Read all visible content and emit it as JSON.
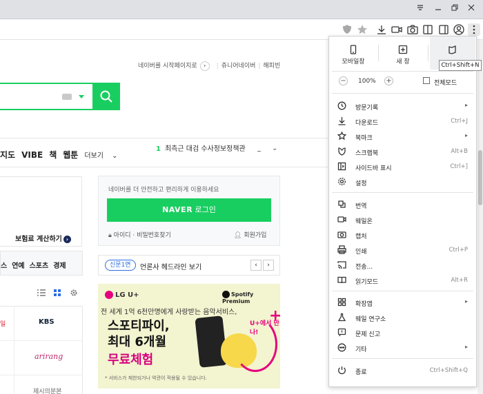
{
  "window": {
    "controls": [
      "tabs-dropdown-icon",
      "minimize-icon",
      "restore-icon",
      "close-icon"
    ]
  },
  "toolbar": {
    "icons": [
      "shield-icon",
      "star-icon",
      "download-icon",
      "camera-video-icon",
      "camera-icon",
      "sidebar-icon",
      "profile-icon",
      "menu-icon"
    ]
  },
  "page": {
    "topline": {
      "start_page": "네이버를 시작페이지로",
      "junior": "쥬니어네이버",
      "happybean": "해피빈"
    },
    "nav": {
      "items": [
        "지도",
        "VIBE",
        "책",
        "웹툰"
      ],
      "more": "더보기"
    },
    "trend": {
      "rank": "1",
      "text": "최측근 대검 수사정보정책관",
      "dash": "_"
    },
    "insurance_link": "보험료 계산하기",
    "category_tabs": [
      "스",
      "연예",
      "스포츠",
      "경제"
    ],
    "login": {
      "message": "네이버를 더 안전하고 편리하게 이용하세요",
      "button_brand": "NAVER",
      "button_label": "로그인",
      "links": "아이디 · 비밀번호찾기",
      "join": "회원가입"
    },
    "news": {
      "badge": "신문1면",
      "text": "언론사 헤드라인 보기"
    },
    "press": {
      "logos": [
        "KBS",
        "arirang",
        "제시의분본"
      ],
      "left_fragments": [
        "일",
        "",
        ""
      ]
    },
    "ad": {
      "brand_left": "LG U+",
      "brand_right": "Spotify Premium",
      "line1": "전 세계 1억 6천만명에게 사랑받는 음악서비스,",
      "headline1": "스포티파이,",
      "headline2": "최대 6개월",
      "headline3": "무료체험",
      "badge": "U+에서 만나!",
      "footnote": "* 서비스가 제한되거나 약관이 적용될 수 있습니다."
    }
  },
  "menu": {
    "top": [
      {
        "label": "모바일창",
        "icon": "mobile-icon"
      },
      {
        "label": "새 창",
        "icon": "new-window-icon"
      },
      {
        "label": "",
        "icon": "private-window-icon"
      }
    ],
    "tooltip": "Ctrl+Shift+N",
    "zoom": {
      "minus": "−",
      "value": "100%",
      "plus": "+",
      "fullscreen": "전체모드"
    },
    "group1": [
      {
        "label": "방문기록",
        "shortcut": "",
        "arrow": "▸",
        "icon": "history-icon"
      },
      {
        "label": "다운로드",
        "shortcut": "Ctrl+J",
        "arrow": "",
        "icon": "download-icon"
      },
      {
        "label": "북마크",
        "shortcut": "",
        "arrow": "▸",
        "icon": "star-icon"
      },
      {
        "label": "스크랩북",
        "shortcut": "Alt+B",
        "arrow": "",
        "icon": "scrapbook-icon"
      },
      {
        "label": "사이드바 표시",
        "shortcut": "Ctrl+]",
        "arrow": "",
        "icon": "sidebar-icon"
      },
      {
        "label": "설정",
        "shortcut": "",
        "arrow": "",
        "icon": "gear-icon"
      }
    ],
    "group2": [
      {
        "label": "번역",
        "shortcut": "",
        "arrow": "",
        "icon": "translate-icon"
      },
      {
        "label": "웨일온",
        "shortcut": "",
        "arrow": "",
        "icon": "video-call-icon"
      },
      {
        "label": "캡처",
        "shortcut": "",
        "arrow": "",
        "icon": "camera-icon"
      },
      {
        "label": "인쇄",
        "shortcut": "Ctrl+P",
        "arrow": "",
        "icon": "print-icon"
      },
      {
        "label": "전송...",
        "shortcut": "",
        "arrow": "",
        "icon": "cast-icon"
      },
      {
        "label": "읽기모드",
        "shortcut": "Alt+R",
        "arrow": "",
        "icon": "reading-mode-icon"
      }
    ],
    "group3": [
      {
        "label": "확장앱",
        "shortcut": "",
        "arrow": "▸",
        "icon": "extensions-icon"
      },
      {
        "label": "웨일 연구소",
        "shortcut": "",
        "arrow": "",
        "icon": "flask-icon"
      },
      {
        "label": "문제 신고",
        "shortcut": "",
        "arrow": "",
        "icon": "report-icon"
      },
      {
        "label": "기타",
        "shortcut": "",
        "arrow": "▸",
        "icon": "more-icon"
      }
    ],
    "exit": {
      "label": "종료",
      "shortcut": "Ctrl+Shift+Q",
      "icon": "power-icon"
    }
  },
  "colors": {
    "naver_green": "#19ce60",
    "accent_magenta": "#e6007e",
    "link_blue": "#2b6de5"
  }
}
